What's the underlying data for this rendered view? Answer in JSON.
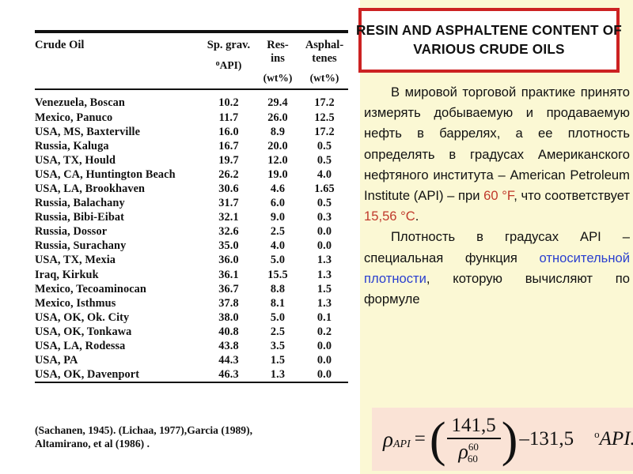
{
  "title_box": {
    "line1": "RESIN AND ASPHALTENE CONTENT OF",
    "line2": "VARIOUS CRUDE OILS",
    "border_color": "#cc2222",
    "background": "#ffffff"
  },
  "table": {
    "columns": [
      {
        "label": "Crude Oil",
        "line2": "",
        "unit": ""
      },
      {
        "label": "Sp. grav.",
        "line2": "",
        "unit": "(°API)"
      },
      {
        "label": "Res-",
        "line2": "ins",
        "unit": "(wt%)"
      },
      {
        "label": "Asphal-",
        "line2": "tenes",
        "unit": "(wt%)"
      }
    ],
    "rows": [
      {
        "name": "Venezuela, Boscan",
        "sp_grav": "10.2",
        "resins": "29.4",
        "asphaltenes": "17.2"
      },
      {
        "name": "Mexico, Panuco",
        "sp_grav": "11.7",
        "resins": "26.0",
        "asphaltenes": "12.5"
      },
      {
        "name": "USA, MS, Baxterville",
        "sp_grav": "16.0",
        "resins": "8.9",
        "asphaltenes": "17.2"
      },
      {
        "name": "Russia, Kaluga",
        "sp_grav": "16.7",
        "resins": "20.0",
        "asphaltenes": "0.5"
      },
      {
        "name": "USA, TX, Hould",
        "sp_grav": "19.7",
        "resins": "12.0",
        "asphaltenes": "0.5"
      },
      {
        "name": "USA, CA, Huntington Beach",
        "sp_grav": "26.2",
        "resins": "19.0",
        "asphaltenes": "4.0"
      },
      {
        "name": "USA, LA, Brookhaven",
        "sp_grav": "30.6",
        "resins": "4.6",
        "asphaltenes": "1.65"
      },
      {
        "name": "Russia, Balachany",
        "sp_grav": "31.7",
        "resins": "6.0",
        "asphaltenes": "0.5"
      },
      {
        "name": "Russia, Bibi-Eibat",
        "sp_grav": "32.1",
        "resins": "9.0",
        "asphaltenes": "0.3"
      },
      {
        "name": "Russia, Dossor",
        "sp_grav": "32.6",
        "resins": "2.5",
        "asphaltenes": "0.0"
      },
      {
        "name": "Russia, Surachany",
        "sp_grav": "35.0",
        "resins": "4.0",
        "asphaltenes": "0.0"
      },
      {
        "name": "USA, TX, Mexia",
        "sp_grav": "36.0",
        "resins": "5.0",
        "asphaltenes": "1.3"
      },
      {
        "name": "Iraq, Kirkuk",
        "sp_grav": "36.1",
        "resins": "15.5",
        "asphaltenes": "1.3"
      },
      {
        "name": "Mexico, Tecoaminocan",
        "sp_grav": "36.7",
        "resins": "8.8",
        "asphaltenes": "1.5"
      },
      {
        "name": "Mexico, Isthmus",
        "sp_grav": "37.8",
        "resins": "8.1",
        "asphaltenes": "1.3"
      },
      {
        "name": "USA, OK, Ok. City",
        "sp_grav": "38.0",
        "resins": "5.0",
        "asphaltenes": "0.1"
      },
      {
        "name": "USA, OK, Tonkawa",
        "sp_grav": "40.8",
        "resins": "2.5",
        "asphaltenes": "0.2"
      },
      {
        "name": "USA, LA, Rodessa",
        "sp_grav": "43.8",
        "resins": "3.5",
        "asphaltenes": "0.0"
      },
      {
        "name": "USA, PA",
        "sp_grav": "44.3",
        "resins": "1.5",
        "asphaltenes": "0.0"
      },
      {
        "name": "USA, OK, Davenport",
        "sp_grav": "46.3",
        "resins": "1.3",
        "asphaltenes": "0.0"
      }
    ]
  },
  "source_note": {
    "line1": "(Sachanen, 1945). (Lichaa, 1977),Garcia (1989),",
    "line2": "Altamirano, et al (1986) ."
  },
  "text_panel": {
    "background": "#fbf8d4",
    "paragraph1": {
      "part1": "В мировой торговой практике принято измерять добываемую и продаваемую нефть в баррелях, а ее плотность определять в градусах Американского нефтяного института – American Petroleum Institute (API) – при ",
      "temp_f": "60 °F",
      "part2": ", что соответствует ",
      "temp_c": "15,56 °C",
      "part3": "."
    },
    "paragraph2": {
      "part1": "Плотность в градусах API – специальная функция ",
      "link": "относительной плотности",
      "part2": ", которую вычисляют по формуле"
    },
    "highlight_red": "#c0392b",
    "highlight_blue": "#2a3fcf"
  },
  "formula": {
    "lhs": "ρ",
    "lhs_sub": "API",
    "equals": "=",
    "numerator": "141,5",
    "denominator_symbol": "ρ",
    "denominator_sup": "60",
    "denominator_sub": "60",
    "minus": "–",
    "constant": "131,5",
    "unit_degree": "o",
    "unit_label": "API.",
    "background": "#fae3d6"
  }
}
